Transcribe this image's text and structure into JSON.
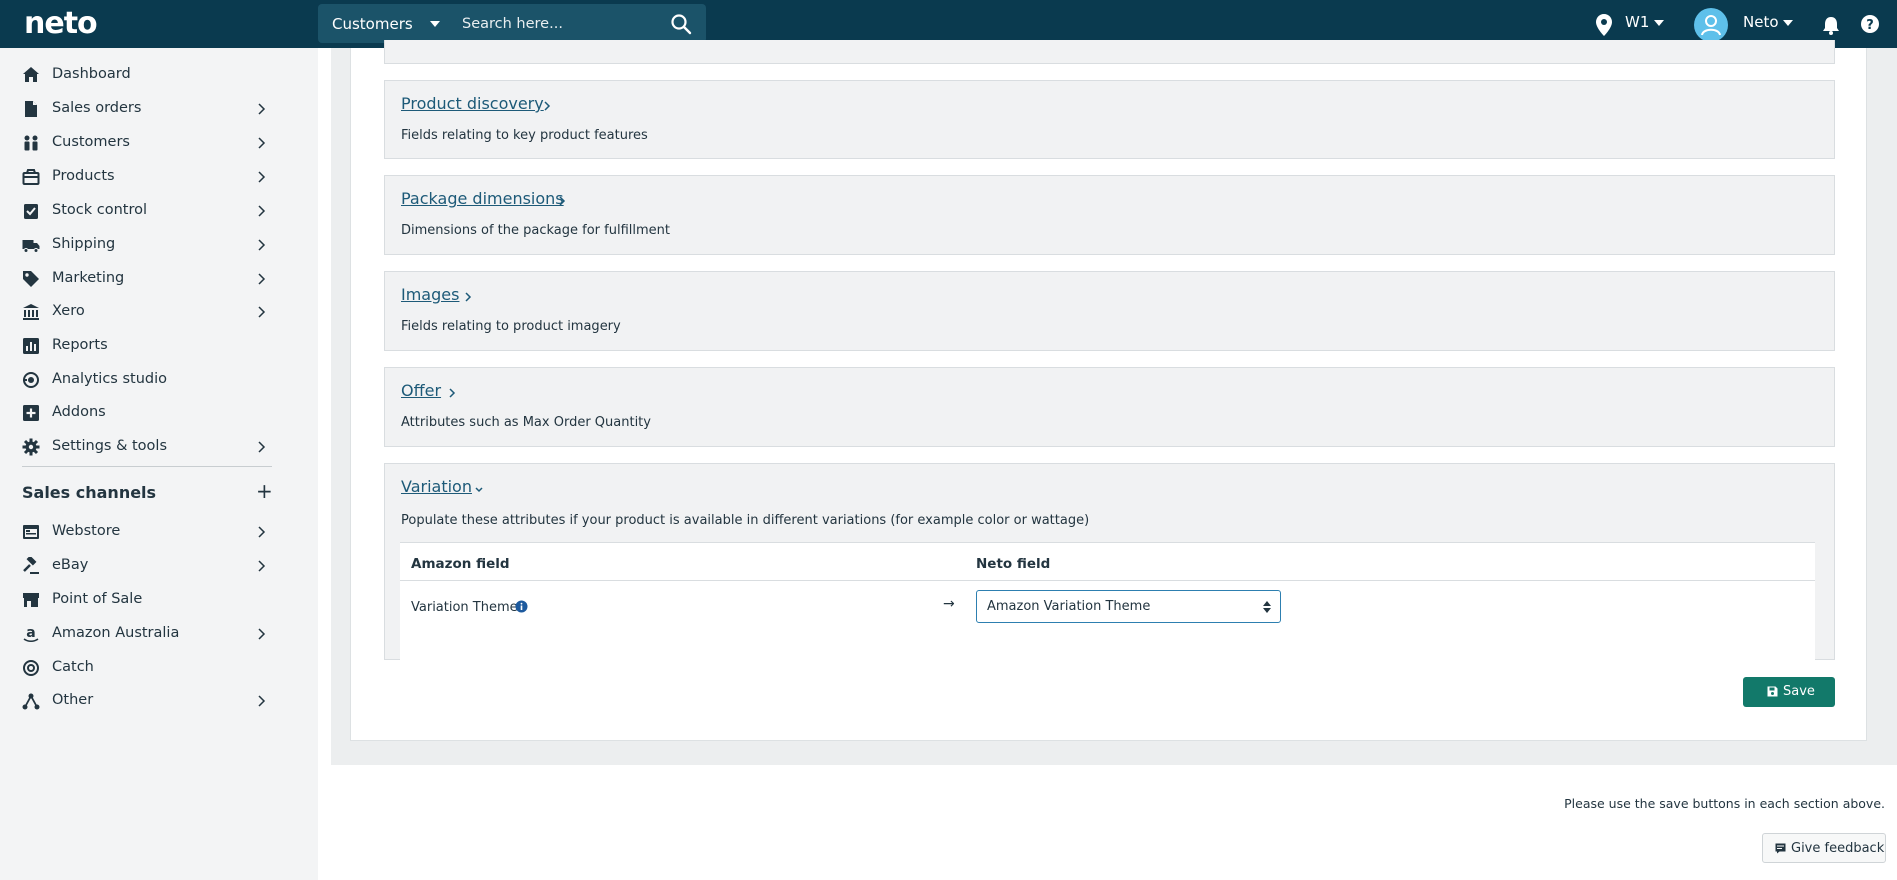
{
  "app": {
    "brand": "neto"
  },
  "topbar": {
    "search_scope": "Customers",
    "search_placeholder": "Search here...",
    "location": "W1",
    "user": "Neto"
  },
  "sidebar": {
    "items": [
      {
        "label": "Dashboard",
        "icon": "home-icon",
        "chevron": false
      },
      {
        "label": "Sales orders",
        "icon": "document-icon",
        "chevron": true
      },
      {
        "label": "Customers",
        "icon": "people-icon",
        "chevron": true
      },
      {
        "label": "Products",
        "icon": "box-icon",
        "chevron": true
      },
      {
        "label": "Stock control",
        "icon": "clipboard-check-icon",
        "chevron": true
      },
      {
        "label": "Shipping",
        "icon": "truck-icon",
        "chevron": true
      },
      {
        "label": "Marketing",
        "icon": "tag-icon",
        "chevron": true
      },
      {
        "label": "Xero",
        "icon": "bank-icon",
        "chevron": true
      },
      {
        "label": "Reports",
        "icon": "bar-chart-icon",
        "chevron": false
      },
      {
        "label": "Analytics studio",
        "icon": "analytics-icon",
        "chevron": false
      },
      {
        "label": "Addons",
        "icon": "plus-square-icon",
        "chevron": false
      },
      {
        "label": "Settings & tools",
        "icon": "gear-icon",
        "chevron": true
      }
    ],
    "channels_heading": "Sales channels",
    "channels_add": "+",
    "channels": [
      {
        "label": "Webstore",
        "icon": "webstore-icon",
        "chevron": true
      },
      {
        "label": "eBay",
        "icon": "gavel-icon",
        "chevron": true
      },
      {
        "label": "Point of Sale",
        "icon": "store-icon",
        "chevron": false
      },
      {
        "label": "Amazon Australia",
        "icon": "amazon-icon",
        "chevron": true
      },
      {
        "label": "Catch",
        "icon": "catch-icon",
        "chevron": false
      },
      {
        "label": "Other",
        "icon": "network-icon",
        "chevron": true
      }
    ]
  },
  "sections": [
    {
      "title": "Product discovery",
      "description": "Fields relating to key product features"
    },
    {
      "title": "Package dimensions",
      "description": "Dimensions of the package for fulfillment"
    },
    {
      "title": "Images",
      "description": "Fields relating to product imagery"
    },
    {
      "title": "Offer",
      "description": "Attributes such as Max Order Quantity"
    },
    {
      "title": "Variation",
      "description": "Populate these attributes if your product is available in different variations (for example color or wattage)"
    }
  ],
  "mapping": {
    "col_amazon": "Amazon field",
    "col_neto": "Neto field",
    "rows": [
      {
        "amazon_field": "Variation Theme",
        "arrow": "→",
        "neto_field": "Amazon Variation Theme"
      }
    ]
  },
  "save_label": "Save",
  "footer": {
    "note": "Please use the save buttons in each section above.",
    "feedback_label": "Give feedback"
  },
  "colors": {
    "topbar": "#0a3a4f",
    "link": "#1d5a78",
    "save": "#12796a",
    "avatar": "#5ec0ea"
  }
}
